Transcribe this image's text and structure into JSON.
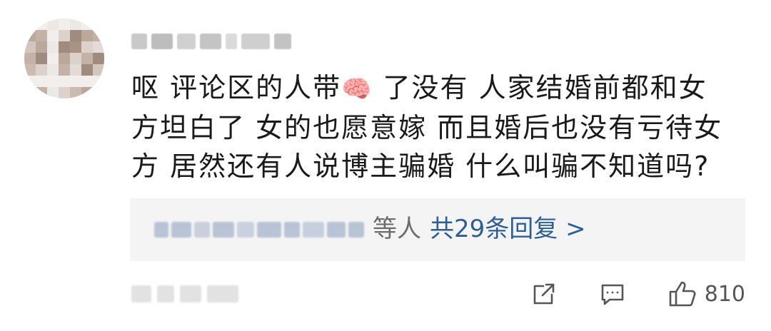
{
  "comment": {
    "lines": [
      {
        "before_emoji": "呕 评论区的人带",
        "emoji": "🧠",
        "after_emoji": " 了没有 人家结婚前都和女"
      },
      {
        "text": "方坦白了 女的也愿意嫁 而且婚后也没有亏待女"
      },
      {
        "text": "方 居然还有人说博主骗婚 什么叫骗不知道吗?"
      }
    ]
  },
  "replies": {
    "suffix": "等人",
    "link_text": "共29条回复 >"
  },
  "actions": {
    "share_icon": "share-icon",
    "comment_icon": "comment-icon",
    "like_icon": "thumbs-up-icon",
    "like_count": "810"
  },
  "colors": {
    "link": "#2f5e94",
    "text": "#1a1a1a",
    "reply_bg": "#f4f4f4"
  }
}
